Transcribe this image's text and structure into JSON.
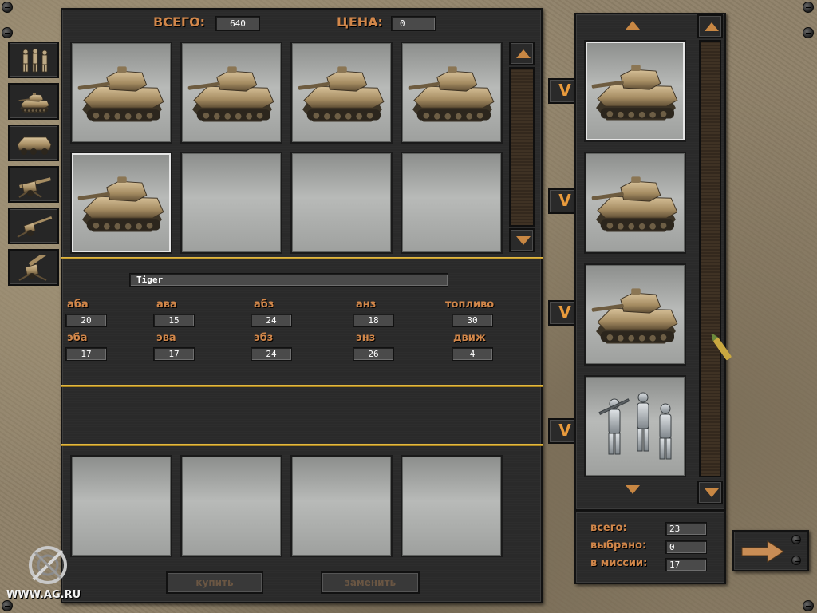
{
  "header": {
    "total_label": "ВСЕГО:",
    "total_value": "640",
    "price_label": "ЦЕНА:",
    "price_value": "0"
  },
  "categories": [
    {
      "icon": "infantry-icon"
    },
    {
      "icon": "tank-icon"
    },
    {
      "icon": "armored-car-icon"
    },
    {
      "icon": "anti-tank-gun-icon"
    },
    {
      "icon": "artillery-icon"
    },
    {
      "icon": "howitzer-icon"
    }
  ],
  "catalog": [
    {
      "unit": "panzer-iii"
    },
    {
      "unit": "panzer-iii"
    },
    {
      "unit": "panzer-iv"
    },
    {
      "unit": "panzer-iv"
    },
    {
      "unit": "tiger"
    },
    {
      "unit": ""
    },
    {
      "unit": ""
    },
    {
      "unit": ""
    }
  ],
  "selected_unit": {
    "name": "Tiger"
  },
  "stats": [
    {
      "label": "аба",
      "value": "20"
    },
    {
      "label": "ава",
      "value": "15"
    },
    {
      "label": "абз",
      "value": "24"
    },
    {
      "label": "анз",
      "value": "18"
    },
    {
      "label": "топливо",
      "value": "30"
    },
    {
      "label": "эба",
      "value": "17"
    },
    {
      "label": "эва",
      "value": "17"
    },
    {
      "label": "эбз",
      "value": "24"
    },
    {
      "label": "энз",
      "value": "26"
    },
    {
      "label": "движ",
      "value": "4"
    }
  ],
  "buttons": {
    "buy": "купить",
    "replace": "заменить",
    "move_down": "V"
  },
  "roster": [
    {
      "unit": "tiger"
    },
    {
      "unit": "tiger"
    },
    {
      "unit": "tiger"
    },
    {
      "unit": "infantry-squad"
    }
  ],
  "summary": {
    "total_label": "всего:",
    "total_value": "23",
    "selected_label": "выбрано:",
    "selected_value": "0",
    "mission_label": "в миссии:",
    "mission_value": "17"
  },
  "watermark": "WWW.AG.RU",
  "colors": {
    "accent_orange": "#d2874a",
    "gold_divider": "#f1c54a",
    "panel": "#2a2a2a"
  }
}
